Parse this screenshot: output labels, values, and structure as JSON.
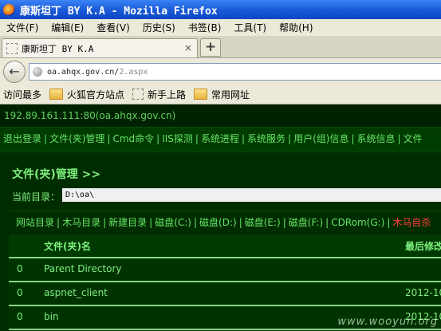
{
  "window": {
    "title": "康斯坦丁 BY K.A - Mozilla Firefox"
  },
  "menu": [
    "文件(F)",
    "编辑(E)",
    "查看(V)",
    "历史(S)",
    "书签(B)",
    "工具(T)",
    "帮助(H)"
  ],
  "tab": {
    "title": "康斯坦丁 BY K.A",
    "close": "×",
    "new_tab": "+"
  },
  "address": {
    "host": "oa.ahqx.gov.cn/",
    "path": "2.aspx"
  },
  "bookmarks": [
    "访问最多",
    "火狐官方站点",
    "新手上路",
    "常用网址"
  ],
  "page": {
    "host_line": "192.89.161.111:80(oa.ahqx.gov.cn)",
    "nav": [
      "退出登录",
      "文件(夹)管理",
      "Cmd命令",
      "IIS探测",
      "系统进程",
      "系统服务",
      "用户(组)信息",
      "系统信息",
      "文件"
    ],
    "heading": "文件(夹)管理 >>",
    "current_dir_label": "当前目录：",
    "current_dir_value": "D:\\oa\\",
    "drives": [
      "网站目录",
      "木马目录",
      "新建目录",
      "磁盘(C:)",
      "磁盘(D:)",
      "磁盘(E:)",
      "磁盘(F:)",
      "CDRom(G:)"
    ],
    "drives_extra": "木马自杀",
    "table": {
      "col_name": "文件(夹)名",
      "col_date": "最后修改",
      "rows": [
        {
          "mark": "0",
          "name": "Parent Directory",
          "date": ""
        },
        {
          "mark": "0",
          "name": "aspnet_client",
          "date": "2012-10"
        },
        {
          "mark": "0",
          "name": "bin",
          "date": "2012-10"
        }
      ]
    }
  },
  "watermark": "www.wooyun.org"
}
